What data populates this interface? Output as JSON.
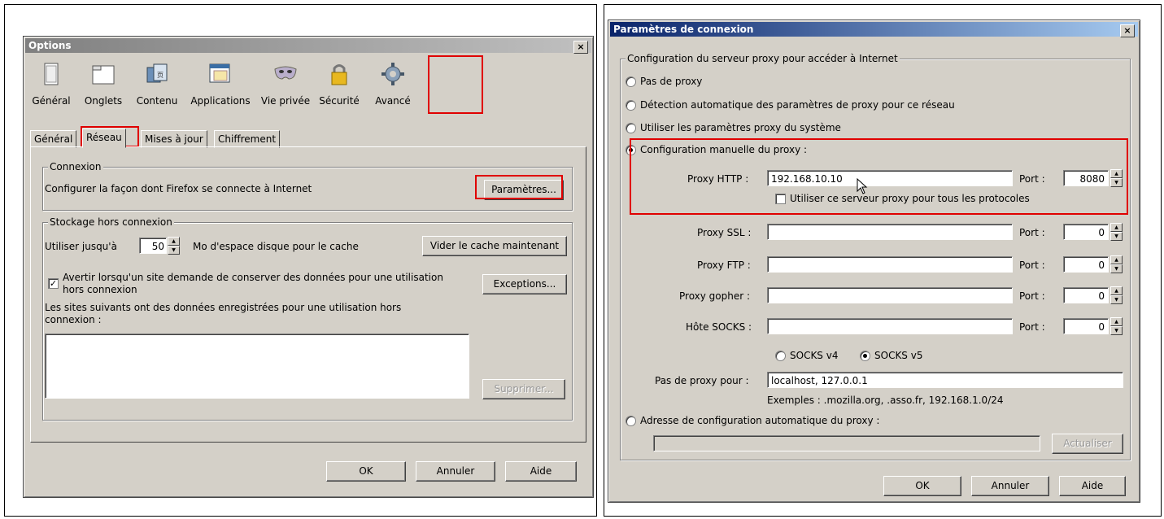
{
  "options": {
    "title": "Options",
    "close": "×",
    "toolbar": [
      {
        "label": "Général",
        "icon": "general-icon"
      },
      {
        "label": "Onglets",
        "icon": "tabs-icon"
      },
      {
        "label": "Contenu",
        "icon": "content-icon"
      },
      {
        "label": "Applications",
        "icon": "applications-icon"
      },
      {
        "label": "Vie privée",
        "icon": "privacy-mask-icon"
      },
      {
        "label": "Sécurité",
        "icon": "lock-icon"
      },
      {
        "label": "Avancé",
        "icon": "gear-icon"
      }
    ],
    "tabs": [
      "Général",
      "Réseau",
      "Mises à jour",
      "Chiffrement"
    ],
    "connexion": {
      "legend": "Connexion",
      "text": "Configurer la façon dont Firefox se connecte à Internet",
      "button": "Paramètres..."
    },
    "storage": {
      "legend": "Stockage hors connexion",
      "use_label": "Utiliser jusqu'à",
      "value": "50",
      "unit_label": "Mo d'espace disque pour le cache",
      "clear_button": "Vider le cache maintenant",
      "warn_checked": "✓",
      "warn_line1": "Avertir lorsqu'un site demande de conserver des données pour une utilisation",
      "warn_line2": "hors connexion",
      "exceptions_button": "Exceptions...",
      "sites_line1": "Les sites suivants ont des données enregistrées pour une utilisation hors",
      "sites_line2": "connexion :",
      "delete_button": "Supprimer..."
    },
    "buttons": {
      "ok": "OK",
      "cancel": "Annuler",
      "help": "Aide"
    }
  },
  "params": {
    "title": "Paramètres de connexion",
    "close": "×",
    "legend": "Configuration du serveur proxy pour accéder à Internet",
    "radio_none": "Pas de proxy",
    "radio_auto": "Détection automatique des paramètres de proxy pour ce réseau",
    "radio_system": "Utiliser les paramètres proxy du système",
    "radio_manual": "Configuration manuelle du proxy :",
    "http_label": "Proxy HTTP :",
    "http_value": "192.168.10.10",
    "port_label": "Port :",
    "http_port": "8080",
    "all_protocols": "Utiliser ce serveur proxy pour tous les protocoles",
    "ssl_label": "Proxy SSL :",
    "ssl_port": "0",
    "ftp_label": "Proxy FTP :",
    "ftp_port": "0",
    "gopher_label": "Proxy gopher :",
    "gopher_port": "0",
    "socks_label": "Hôte SOCKS :",
    "socks_port": "0",
    "socks_v4": "SOCKS v4",
    "socks_v5": "SOCKS v5",
    "noproxy_label": "Pas de proxy pour :",
    "noproxy_value": "localhost, 127.0.0.1",
    "examples": "Exemples : .mozilla.org, .asso.fr, 192.168.1.0/24",
    "radio_pac": "Adresse de configuration automatique du proxy :",
    "reload_button": "Actualiser",
    "buttons": {
      "ok": "OK",
      "cancel": "Annuler",
      "help": "Aide"
    }
  },
  "colors": {
    "title_left": "#0a246a",
    "title_right": "#a6caf0",
    "title_inactive_left": "#808080",
    "title_inactive_right": "#c0c0c0",
    "highlight": "#e00000"
  }
}
